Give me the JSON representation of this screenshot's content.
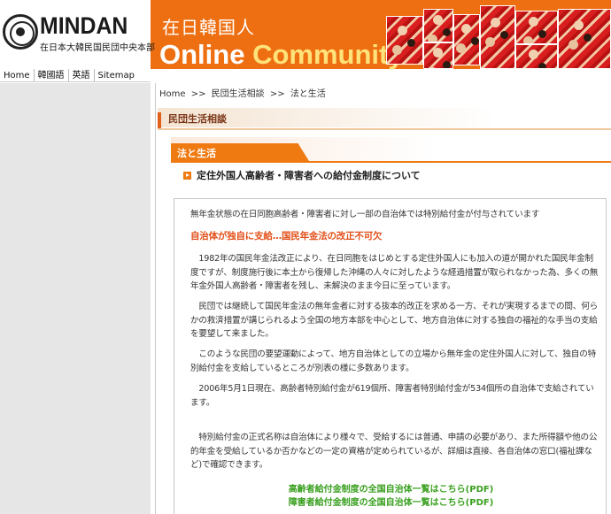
{
  "header": {
    "logo_text": "MINDAN",
    "logo_subtext": "在日本大韓民国民団中央本部",
    "title_jp": "在日韓国人",
    "title_en_1": "Online",
    "title_en_2": "Community"
  },
  "topnav": [
    "Home",
    "韓國語",
    "英語",
    "Sitemap"
  ],
  "breadcrumb": [
    "Home",
    ">>",
    "民団生活相談",
    ">>",
    "法と生活"
  ],
  "section": {
    "title": "民団生活相談"
  },
  "subsection": {
    "title": "法と生活"
  },
  "article": {
    "title": "定住外国人高齢者・障害者への給付金制度について",
    "lead": "無年金状態の在日同胞高齢者・障害者に対し一部の自治体では特別給付金が付与されています",
    "subhead": "自治体が独自に支給…国民年金法の改正不可欠",
    "para1": "　1982年の国民年金法改正により、在日同胞をはじめとする定住外国人にも加入の道が開かれた国民年金制度ですが、制度施行後に本土から復帰した沖縄の人々に対したような経過措置が取られなかった為、多くの無年金外国人高齢者・障害者を残し、未解決のまま今日に至っています。",
    "para2": "　民団では継続して国民年金法の無年金者に対する抜本的改正を求める一方、それが実現するまでの間、何らかの救済措置が講じられるよう全国の地方本部を中心として、地方自治体に対する独自の福祉的な手当の支給を要望して来ました。",
    "para3": "　このような民団の要望運動によって、地方自治体としての立場から無年金の定住外国人に対して、独自の特別給付金を支給しているところが別表の様に多数あります。",
    "para4": "　2006年5月1日現在、高齢者特別給付金が619個所、障害者特別給付金が534個所の自治体で支給されています。",
    "para5": "　特別給付金の正式名称は自治体により様々で、受給するには普通、申請の必要があり、また所得額や他の公的年金を受給しているか否かなどの一定の資格が定められているが、詳細は直接、各自治体の窓口(福祉課など)で確認できます。",
    "pdf_link_1": "高齢者給付金制度の全国自治体一覧はこちら(PDF)",
    "pdf_link_2": "障害者給付金制度の全国自治体一覧はこちら(PDF)"
  },
  "colors": {
    "brand_orange": "#ee6f12",
    "link_green": "#3aa020",
    "subhead_red": "#e2501a",
    "sidebar_gray": "#e6e6e6"
  }
}
